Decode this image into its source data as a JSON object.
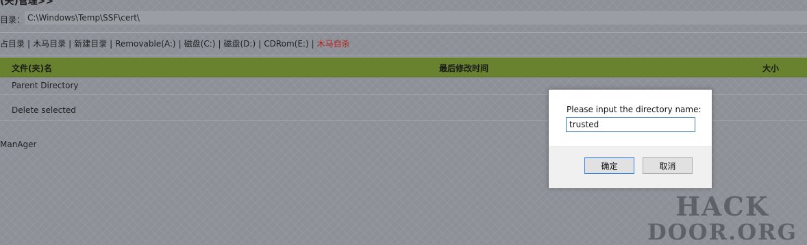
{
  "page": {
    "title": "(夹)管理>>",
    "directory_label": "目录：",
    "directory_value": "C:\\Windows\\Temp\\SSF\\cert\\"
  },
  "nav": {
    "items": [
      {
        "label": "占目录"
      },
      {
        "label": "木马目录"
      },
      {
        "label": "新建目录"
      },
      {
        "label": "Removable(A:)"
      },
      {
        "label": "磁盘(C:)"
      },
      {
        "label": "磁盘(D:)"
      },
      {
        "label": "CDRom(E:)"
      },
      {
        "label": "木马自杀",
        "color": "#b3211b"
      }
    ],
    "separator": "|"
  },
  "table": {
    "columns": [
      "文件(夹)名",
      "最后修改时间",
      "大小"
    ],
    "header_color": "#68822f",
    "rows": [
      "Parent Directory",
      "Delete selected"
    ]
  },
  "footer": {
    "text": "ManAger"
  },
  "dialog": {
    "prompt": "Please input the directory name:",
    "input_value": "trusted",
    "ok_label": "确定",
    "cancel_label": "取消"
  },
  "watermark": {
    "line1": "HACK",
    "line2": "DOOR.ORG"
  }
}
